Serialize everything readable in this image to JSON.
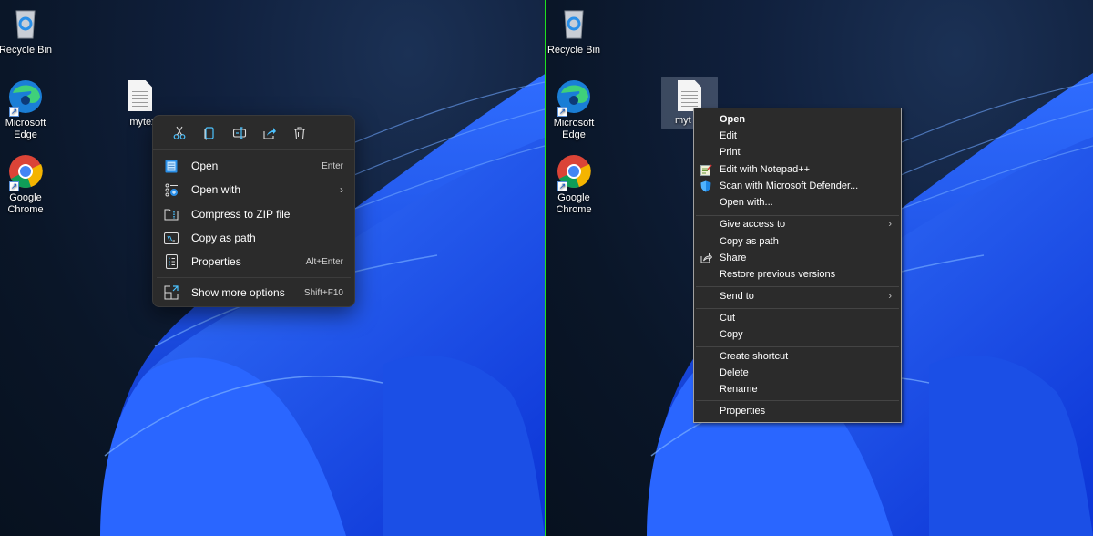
{
  "desktop_icons": {
    "recycle_bin": "Recycle Bin",
    "edge_line1": "Microsoft",
    "edge_line2": "Edge",
    "chrome_line1": "Google",
    "chrome_line2": "Chrome",
    "file_left": "mytex",
    "file_right": "myt"
  },
  "win11_menu": {
    "toolbar": [
      {
        "icon": "cut-icon",
        "glyph": "✂"
      },
      {
        "icon": "copy-icon",
        "glyph": "⧉"
      },
      {
        "icon": "rename-icon",
        "glyph": "⌶"
      },
      {
        "icon": "share-icon",
        "glyph": "⇪"
      },
      {
        "icon": "delete-icon",
        "glyph": "🗑"
      }
    ],
    "items": [
      {
        "label": "Open",
        "accel": "Enter",
        "icon": "notepad-icon"
      },
      {
        "label": "Open with",
        "accel": "",
        "icon": "open-with-icon",
        "submenu": "›"
      },
      {
        "label": "Compress to ZIP file",
        "accel": "",
        "icon": "zip-folder-icon"
      },
      {
        "label": "Copy as path",
        "accel": "",
        "icon": "copy-path-icon"
      },
      {
        "label": "Properties",
        "accel": "Alt+Enter",
        "icon": "properties-icon"
      },
      {
        "label": "Show more options",
        "accel": "Shift+F10",
        "icon": "show-more-icon"
      }
    ]
  },
  "classic_menu": {
    "items": [
      {
        "label": "Open"
      },
      {
        "label": "Edit"
      },
      {
        "label": "Print"
      },
      {
        "label": "Edit with Notepad++"
      },
      {
        "label": "Scan with Microsoft Defender..."
      },
      {
        "label": "Open with..."
      },
      {
        "label": "Give access to",
        "submenu": "›"
      },
      {
        "label": "Copy as path"
      },
      {
        "label": "Share"
      },
      {
        "label": "Restore previous versions"
      },
      {
        "label": "Send to",
        "submenu": "›"
      },
      {
        "label": "Cut"
      },
      {
        "label": "Copy"
      },
      {
        "label": "Create shortcut"
      },
      {
        "label": "Delete"
      },
      {
        "label": "Rename"
      },
      {
        "label": "Properties"
      }
    ]
  },
  "colors": {
    "menu_bg": "#2b2b2b",
    "accent_icon": "#4cc2ff",
    "split_line": "#1fe01f",
    "wallpaper_bloom": "#1f55f0"
  }
}
